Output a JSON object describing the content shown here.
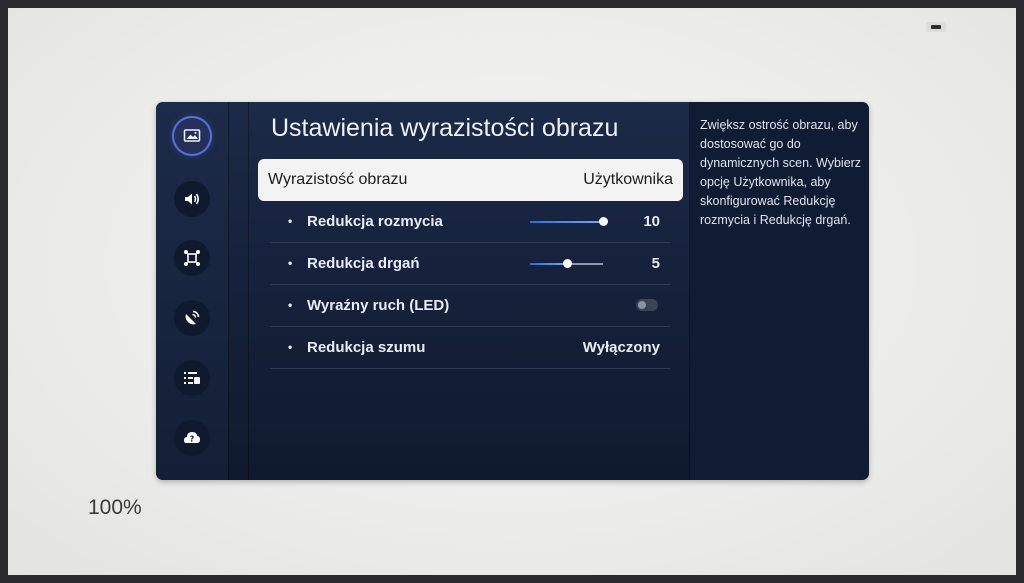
{
  "header": {
    "title": "Ustawienia wyrazistości obrazu"
  },
  "selected_setting": {
    "label": "Wyrazistość obrazu",
    "value": "Użytkownika"
  },
  "settings": [
    {
      "label": "Redukcja rozmycia",
      "type": "slider",
      "value": "10",
      "level": 10,
      "max": 10
    },
    {
      "label": "Redukcja drgań",
      "type": "slider",
      "value": "5",
      "level": 5,
      "max": 10
    },
    {
      "label": "Wyraźny ruch (LED)",
      "type": "toggle",
      "state": "off"
    },
    {
      "label": "Redukcja szumu",
      "type": "select",
      "value": "Wyłączony"
    }
  ],
  "help": {
    "text": "Zwiększ ostrość obrazu, aby dostosować go do dynamicznych scen. Wybierz opcję Użytkownika, aby skonfigurować Redukcję rozmycia i Redukcję drgań."
  },
  "status": {
    "zoom": "100%"
  },
  "nav": {
    "items": [
      {
        "icon": "picture-icon",
        "active": true
      },
      {
        "icon": "sound-icon",
        "active": false
      },
      {
        "icon": "connection-icon",
        "active": false
      },
      {
        "icon": "broadcast-icon",
        "active": false
      },
      {
        "icon": "general-settings-icon",
        "active": false
      },
      {
        "icon": "support-icon",
        "active": false
      }
    ]
  },
  "colors": {
    "accent": "#5a6fe0",
    "panel": "#16223c",
    "highlight": "#f3f3f3"
  }
}
